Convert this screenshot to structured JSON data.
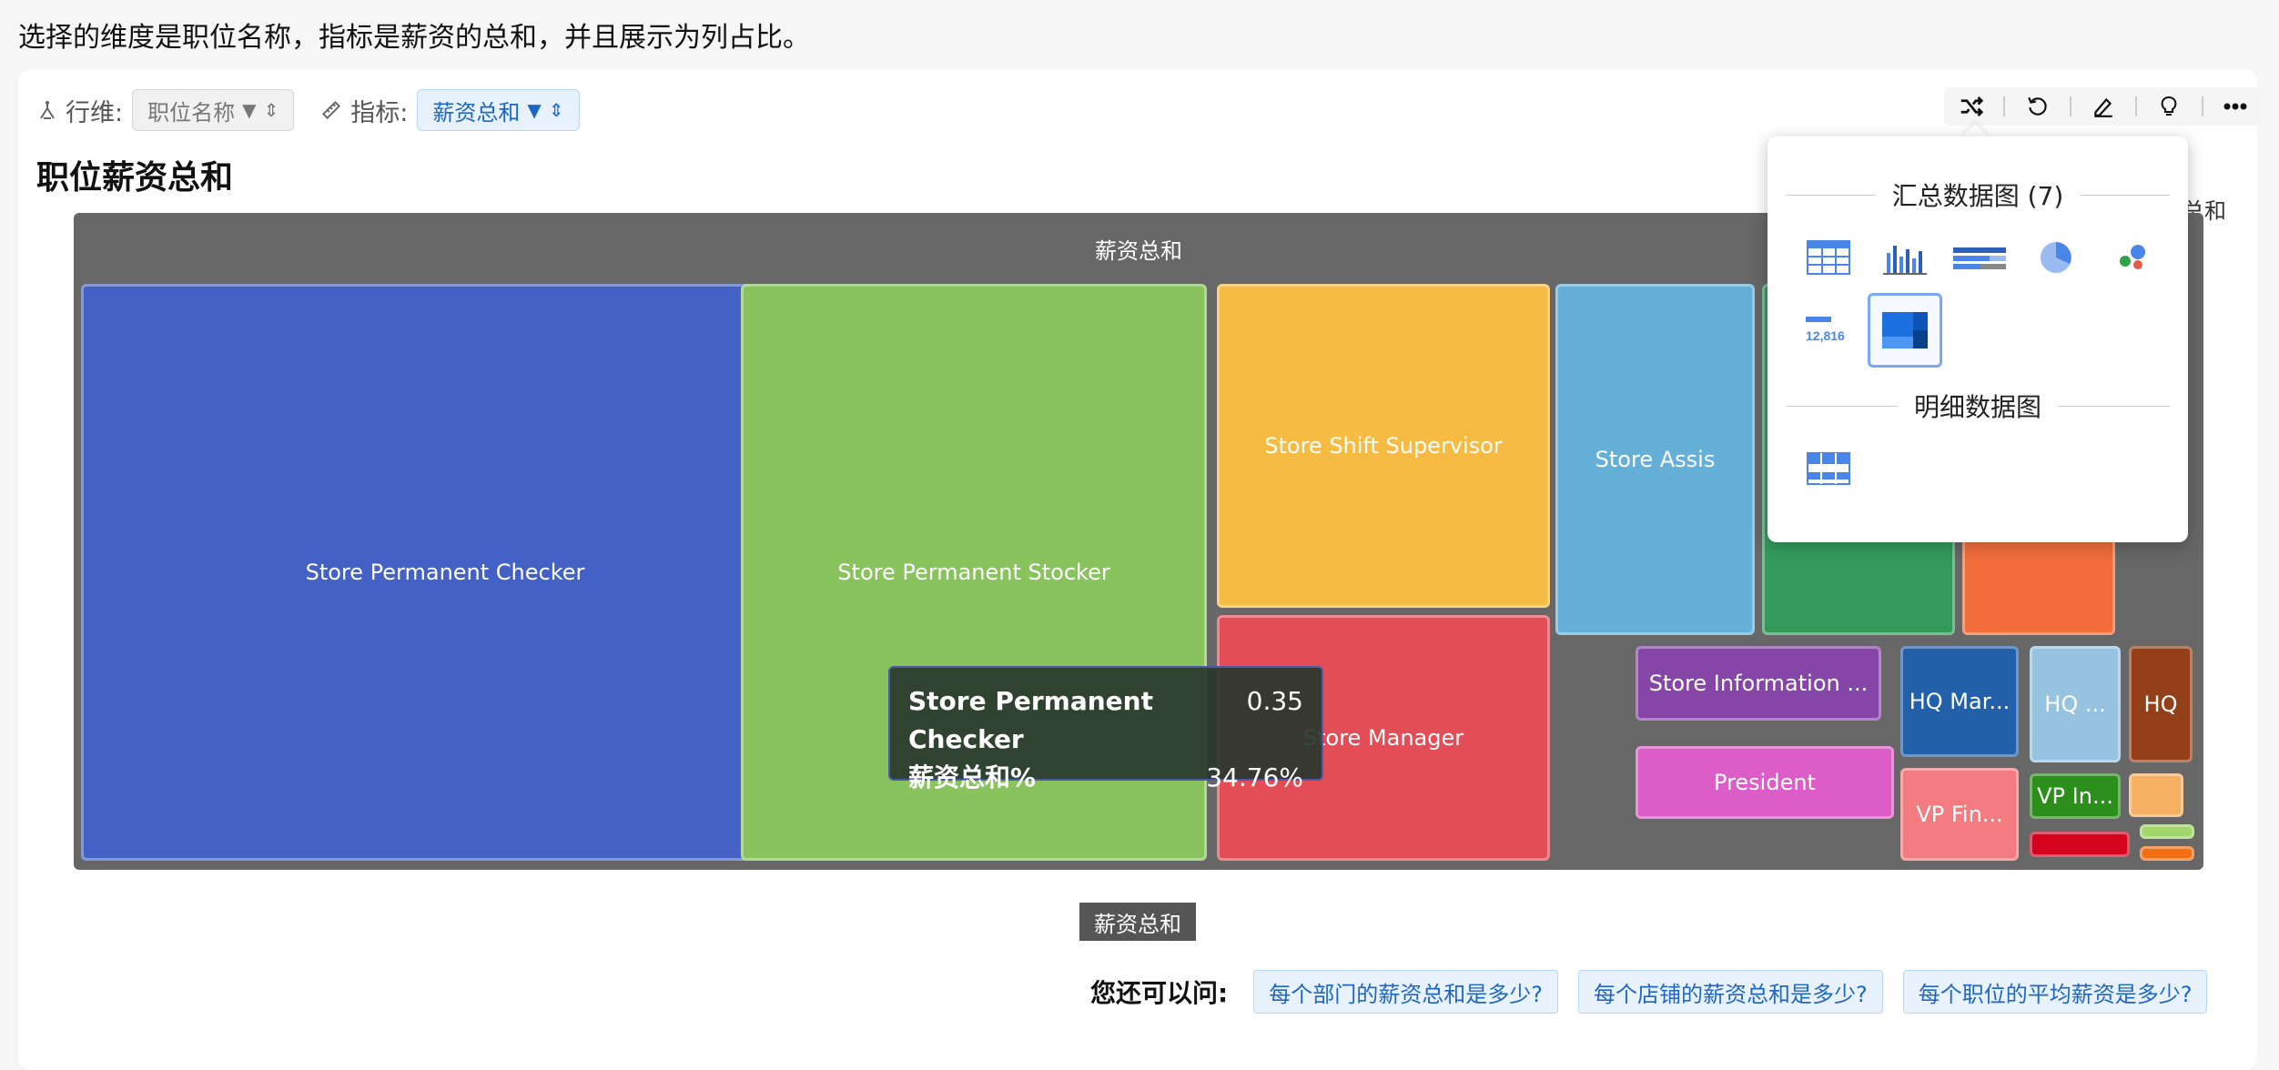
{
  "question": "选择的维度是职位名称，指标是薪资的总和，并且展示为列占比。",
  "toolbar": {
    "row_label": "行维:",
    "row_value": "职位名称",
    "metric_label": "指标:",
    "metric_value": "薪资总和"
  },
  "chart_title": "职位薪资总和",
  "outside_note": "总和",
  "popup": {
    "summary_heading": "汇总数据图 (7)",
    "detail_heading": "明细数据图",
    "kpi_icon_text": "12,816"
  },
  "chart_data": {
    "type": "treemap",
    "title": "职位薪资总和",
    "root_label": "薪资总和",
    "legend": "薪资总和",
    "nodes": [
      {
        "label": "Store Permanent Checker",
        "color": "#4461c5"
      },
      {
        "label": "Store Permanent Stocker",
        "color": "#88c35d"
      },
      {
        "label": "Store Shift Supervisor",
        "color": "#f6bb42"
      },
      {
        "label": "Store Manager",
        "color": "#e24d56"
      },
      {
        "label": "Store Assis",
        "color": "#64b0d9"
      },
      {
        "label": "",
        "color": "#349a5c"
      },
      {
        "label": "",
        "color": "#f26d3b"
      },
      {
        "label": "Store Information ...",
        "color": "#8646a8"
      },
      {
        "label": "President",
        "color": "#dc5cc8"
      },
      {
        "label": "HQ Mar...",
        "color": "#2360aa"
      },
      {
        "label": "VP Fin...",
        "color": "#f47c80"
      },
      {
        "label": "HQ ...",
        "color": "#95c3e0"
      },
      {
        "label": "VP In...",
        "color": "#2c8f1c"
      },
      {
        "label": "HQ",
        "color": "#934019"
      },
      {
        "label": "",
        "color": "#f6b063"
      },
      {
        "label": "",
        "color": "#d4031e"
      },
      {
        "label": "",
        "color": "#a2d56a"
      },
      {
        "label": "",
        "color": "#f26f16"
      }
    ],
    "tooltip": {
      "name": "Store Permanent Checker",
      "value": "0.35",
      "metric": "薪资总和%",
      "percent": "34.76%"
    }
  },
  "suggestions": {
    "label": "您还可以问:",
    "items": [
      "每个部门的薪资总和是多少?",
      "每个店铺的薪资总和是多少?",
      "每个职位的平均薪资是多少?"
    ]
  },
  "colors": {
    "accent": "#1f66c4",
    "chip_bg": "#e8f2fd"
  }
}
